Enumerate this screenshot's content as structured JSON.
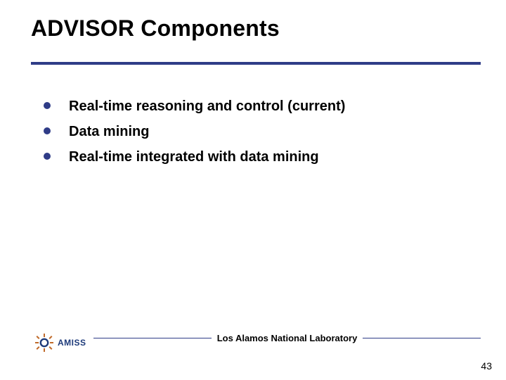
{
  "title": "ADVISOR Components",
  "bullets": [
    "Real-time reasoning and control (current)",
    "Data mining",
    "Real-time integrated with data mining"
  ],
  "footer": {
    "lab": "Los Alamos National Laboratory",
    "logo_text": "AMISS",
    "page_number": "43"
  },
  "colors": {
    "accent": "#2f3c87"
  }
}
